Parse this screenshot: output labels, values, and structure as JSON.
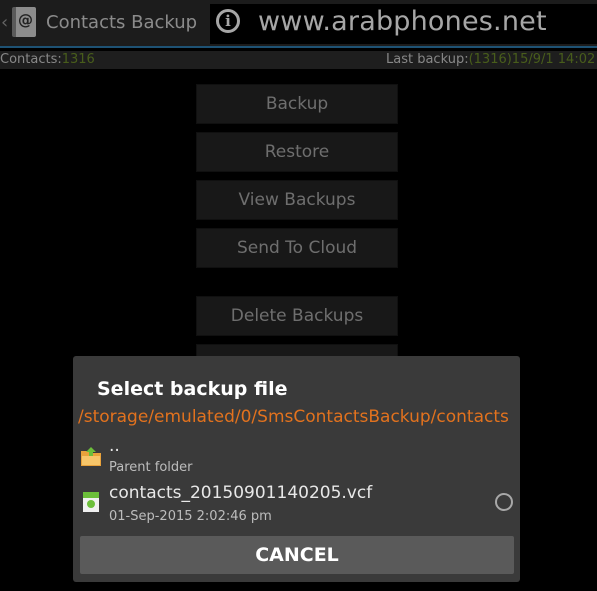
{
  "actionbar": {
    "title": "Contacts Backup",
    "back_icon": "chevron-left-icon",
    "app_icon_glyph": "@",
    "watermark": {
      "icon": "info-icon",
      "icon_glyph": "i",
      "text": "www.arabphones.net"
    },
    "accent_color": "#2f7fb3"
  },
  "status": {
    "contacts_label": "Contacts:",
    "contacts_count": "1316",
    "last_backup_label": "Last backup:",
    "last_backup_value": "(1316)15/9/1 14:02",
    "value_color": "#6f8f2a"
  },
  "menu": {
    "buttons": [
      {
        "label": "Backup"
      },
      {
        "label": "Restore"
      },
      {
        "label": "View Backups"
      },
      {
        "label": "Send To Cloud"
      },
      {
        "label": "Delete Backups"
      }
    ]
  },
  "dialog": {
    "title": "Select backup file",
    "path": "/storage/emulated/0/SmsContactsBackup/contacts",
    "path_color": "#e2721e",
    "items": [
      {
        "name": "..",
        "sub": "Parent folder",
        "icon": "folder-up-icon"
      },
      {
        "name": "contacts_20150901140205.vcf",
        "sub": "01-Sep-2015 2:02:46 pm",
        "icon": "vcf-file-icon",
        "selected": false
      }
    ],
    "cancel_label": "CANCEL"
  }
}
